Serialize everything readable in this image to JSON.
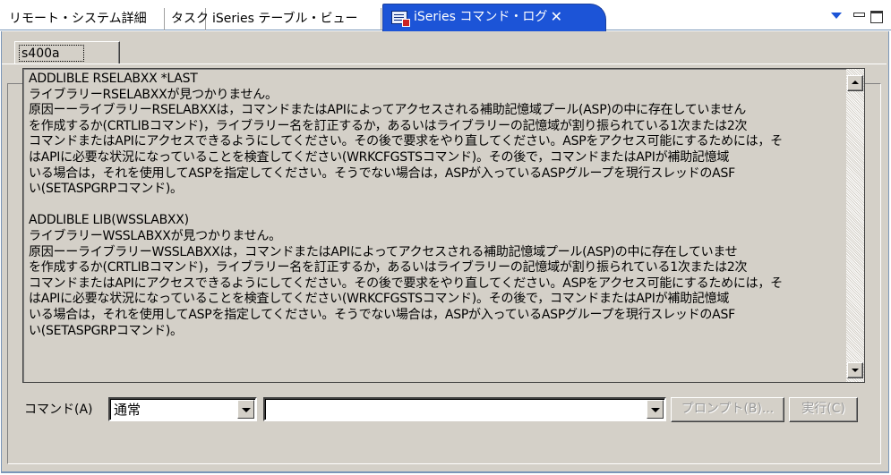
{
  "tabs": [
    {
      "label": "リモート・システム詳細"
    },
    {
      "label": "タスク"
    },
    {
      "label": "iSeries テーブル・ビュー"
    },
    {
      "label": "iSeries コマンド・ログ",
      "active": true
    }
  ],
  "tab_close_glyph": "✕",
  "window_controls": {
    "menu_icon": "view-menu-icon",
    "minimize_icon": "minimize-icon",
    "maximize_icon": "maximize-icon"
  },
  "system_tab": {
    "label": "s400a"
  },
  "log": {
    "lines": [
      "ADDLIBLE RSELABXX *LAST",
      "ライブラリーRSELABXXが見つかりません。",
      "原因ーーライブラリーRSELABXXは，コマンドまたはAPIによってアクセスされる補助記憶域プール(ASP)の中に存在していません",
      "を作成するか(CRTLIBコマンド)，ライブラリー名を訂正するか，あるいはライブラリーの記憶域が割り振られている1次または2次",
      "コマンドまたはAPIにアクセスできるようにしてください。その後で要求をやり直してください。ASPをアクセス可能にするためには，そ",
      "はAPIに必要な状況になっていることを検査してください(WRKCFGSTSコマンド)。その後で，コマンドまたはAPIが補助記憶域",
      "いる場合は，それを使用してASPを指定してください。そうでない場合は，ASPが入っているASPグループを現行スレッドのASF",
      "い(SETASPGRPコマンド)。",
      "",
      "ADDLIBLE LIB(WSSLABXX)",
      "ライブラリーWSSLABXXが見つかりません。",
      "原因ーーライブラリーWSSLABXXは，コマンドまたはAPIによってアクセスされる補助記憶域プール(ASP)の中に存在していませ",
      "を作成するか(CRTLIBコマンド)，ライブラリー名を訂正するか，あるいはライブラリーの記憶域が割り振られている1次または2次",
      "コマンドまたはAPIにアクセスできるようにしてください。その後で要求をやり直してください。ASPをアクセス可能にするためには，そ",
      "はAPIに必要な状況になっていることを検査してください(WRKCFGSTSコマンド)。その後で，コマンドまたはAPIが補助記憶域",
      "いる場合は，それを使用してASPを指定してください。そうでない場合は，ASPが入っているASPグループを現行スレッドのASF",
      "い(SETASPGRPコマンド)。"
    ]
  },
  "command_bar": {
    "label": "コマンド(A)",
    "mode_value": "通常",
    "command_value": "",
    "prompt_button": "プロンプト(B)...",
    "run_button": "実行(C)"
  }
}
